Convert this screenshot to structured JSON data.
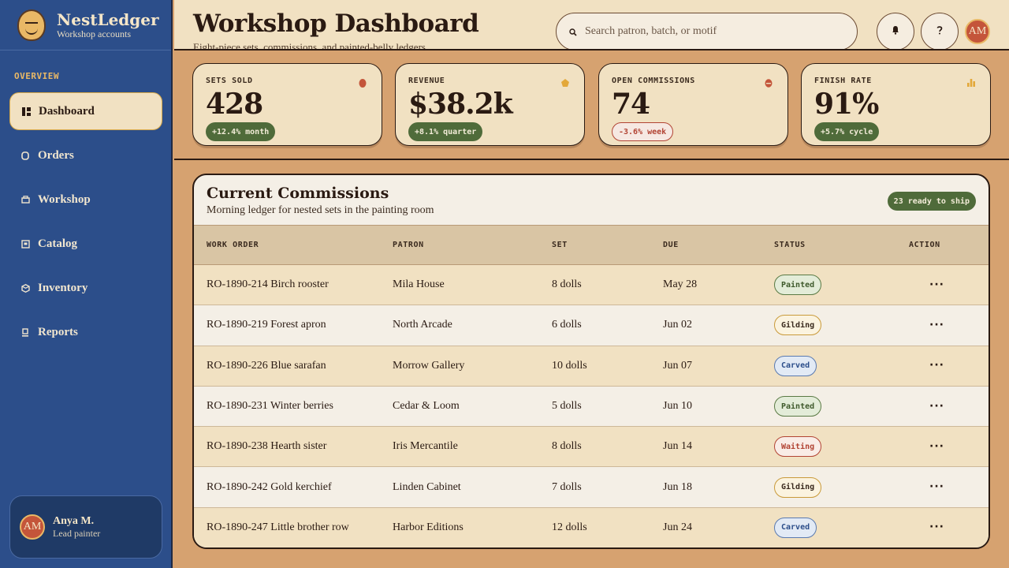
{
  "brand": {
    "name": "NestLedger",
    "subtitle": "Workshop accounts"
  },
  "sidebar": {
    "section_label": "OVERVIEW",
    "items": [
      {
        "label": "Dashboard",
        "icon": "dashboard-icon",
        "active": true
      },
      {
        "label": "Orders",
        "icon": "orders-icon"
      },
      {
        "label": "Workshop",
        "icon": "workshop-icon"
      },
      {
        "label": "Catalog",
        "icon": "catalog-icon"
      },
      {
        "label": "Inventory",
        "icon": "inventory-icon"
      },
      {
        "label": "Reports",
        "icon": "reports-icon"
      }
    ],
    "user": {
      "initials": "AM",
      "name": "Anya M.",
      "role": "Lead painter"
    }
  },
  "header": {
    "title": "Workshop Dashboard",
    "subtitle": "Eight-piece sets, commissions, and painted-belly ledgers",
    "search_placeholder": "Search patron, batch, or motif",
    "avatar_initials": "AM"
  },
  "stats": [
    {
      "label": "SETS SOLD",
      "value": "428",
      "delta": "+12.4% month",
      "trend": "up",
      "dot_color": "#c4553a"
    },
    {
      "label": "REVENUE",
      "value": "$38.2k",
      "delta": "+8.1% quarter",
      "trend": "up",
      "dot_color": "#e3a83a"
    },
    {
      "label": "OPEN COMMISSIONS",
      "value": "74",
      "delta": "-3.6% week",
      "trend": "down",
      "dot_color": "#c4553a"
    },
    {
      "label": "FINISH RATE",
      "value": "91%",
      "delta": "+5.7% cycle",
      "trend": "up",
      "dot_color": "#e3a83a"
    }
  ],
  "commissions": {
    "title": "Current Commissions",
    "subtitle": "Morning ledger for nested sets in the painting room",
    "ready_badge": "23 ready to ship",
    "columns": [
      "WORK ORDER",
      "PATRON",
      "SET",
      "DUE",
      "STATUS",
      "ACTION"
    ],
    "rows": [
      {
        "order": "RO-1890-214 Birch rooster",
        "patron": "Mila House",
        "set": "8 dolls",
        "due": "May 28",
        "status": "Painted"
      },
      {
        "order": "RO-1890-219 Forest apron",
        "patron": "North Arcade",
        "set": "6 dolls",
        "due": "Jun 02",
        "status": "Gilding"
      },
      {
        "order": "RO-1890-226 Blue sarafan",
        "patron": "Morrow Gallery",
        "set": "10 dolls",
        "due": "Jun 07",
        "status": "Carved"
      },
      {
        "order": "RO-1890-231 Winter berries",
        "patron": "Cedar & Loom",
        "set": "5 dolls",
        "due": "Jun 10",
        "status": "Painted"
      },
      {
        "order": "RO-1890-238 Hearth sister",
        "patron": "Iris Mercantile",
        "set": "8 dolls",
        "due": "Jun 14",
        "status": "Waiting"
      },
      {
        "order": "RO-1890-242 Gold kerchief",
        "patron": "Linden Cabinet",
        "set": "7 dolls",
        "due": "Jun 18",
        "status": "Gilding"
      },
      {
        "order": "RO-1890-247 Little brother row",
        "patron": "Harbor Editions",
        "set": "12 dolls",
        "due": "Jun 24",
        "status": "Carved"
      }
    ],
    "action_label": "···"
  }
}
